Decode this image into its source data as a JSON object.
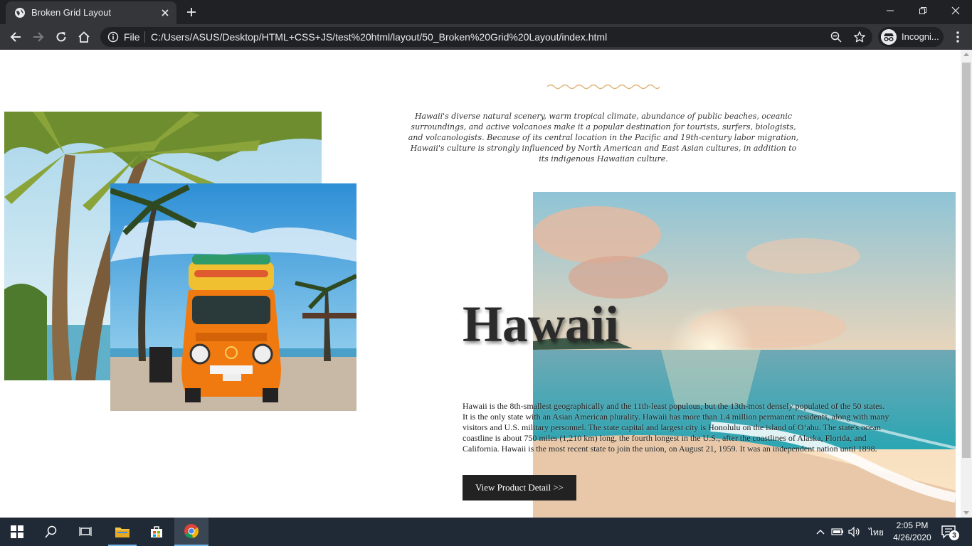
{
  "browser": {
    "tab_title": "Broken Grid Layout",
    "omnibox_scheme": "File",
    "url": "C:/Users/ASUS/Desktop/HTML+CSS+JS/test%20html/layout/50_Broken%20Grid%20Layout/index.html",
    "profile_label": "Incogni...",
    "icons": [
      "globe-icon",
      "close-icon",
      "plus-icon",
      "minimize-icon",
      "restore-icon",
      "back-icon",
      "forward-icon",
      "reload-icon",
      "home-icon",
      "info-icon",
      "zoom-icon",
      "star-icon",
      "incognito-icon",
      "more-vert-icon"
    ]
  },
  "page": {
    "intro": "Hawaii's diverse natural scenery, warm tropical climate, abundance of public beaches, oceanic surroundings, and active volcanoes make it a popular destination for tourists, surfers, biologists, and volcanologists. Because of its central location in the Pacific and 19th-century labor migration, Hawaii's culture is strongly influenced by North American and East Asian cultures, in addition to its indigenous Hawaiian culture.",
    "title": "Hawaii",
    "body": "Hawaii is the 8th-smallest geographically and the 11th-least populous, but the 13th-most densely populated of the 50 states. It is the only state with an Asian American plurality. Hawaii has more than 1.4 million permanent residents, along with many visitors and U.S. military personnel. The state capital and largest city is Honolulu on the island of O‘ahu. The state's ocean coastline is about 750 miles (1,210 km) long, the fourth longest in the U.S., after the coastlines of Alaska, Florida, and California. Hawaii is the most recent state to join the union, on August 21, 1959. It was an independent nation until 1898.",
    "cta_label": "View Product Detail >>",
    "images": [
      "palm-trees-photo",
      "orange-van-photo",
      "beach-sunset-photo"
    ],
    "accent_color": "#e0b27a"
  },
  "taskbar": {
    "icons": [
      "windows-start-icon",
      "search-icon",
      "task-view-icon",
      "file-explorer-icon",
      "store-icon",
      "chrome-icon",
      "chevron-up-icon",
      "battery-icon",
      "volume-icon",
      "notification-icon"
    ],
    "language": "ไทย",
    "time": "2:05 PM",
    "date": "4/26/2020",
    "notification_count": "3"
  }
}
